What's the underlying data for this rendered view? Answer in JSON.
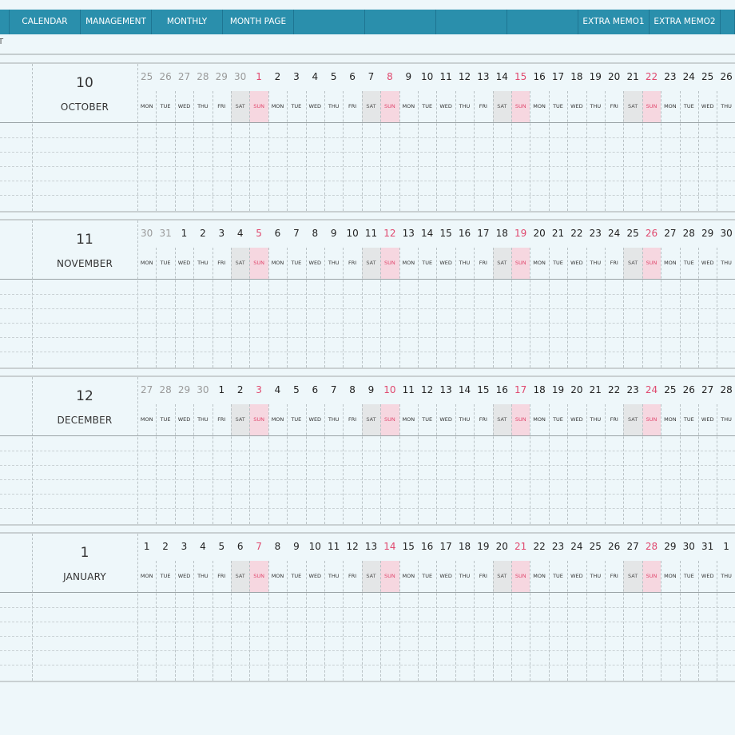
{
  "header": {
    "tabs": [
      {
        "id": "calendar",
        "label": "CALENDAR"
      },
      {
        "id": "management",
        "label": "MANAGEMENT"
      },
      {
        "id": "monthly",
        "label": "MONTHLY"
      },
      {
        "id": "month-page",
        "label": "MONTH PAGE"
      },
      {
        "id": "blank-1",
        "label": ""
      },
      {
        "id": "blank-2",
        "label": ""
      },
      {
        "id": "blank-3",
        "label": ""
      },
      {
        "id": "extra-memo1",
        "label": "EXTRA MEMO1"
      },
      {
        "id": "extra-memo2",
        "label": "EXTRA MEMO2"
      }
    ]
  },
  "sub_label": "T",
  "months": [
    {
      "number": "10",
      "name": "OCTOBER",
      "days": [
        {
          "n": "25",
          "d": "MON",
          "t": "other"
        },
        {
          "n": "26",
          "d": "TUE",
          "t": "other"
        },
        {
          "n": "27",
          "d": "WED",
          "t": "other"
        },
        {
          "n": "28",
          "d": "THU",
          "t": "other"
        },
        {
          "n": "29",
          "d": "FRI",
          "t": "other"
        },
        {
          "n": "30",
          "d": "SAT",
          "t": "other-sat"
        },
        {
          "n": "1",
          "d": "SUN",
          "t": "sun"
        },
        {
          "n": "2",
          "d": "MON",
          "t": ""
        },
        {
          "n": "3",
          "d": "TUE",
          "t": ""
        },
        {
          "n": "4",
          "d": "WED",
          "t": ""
        },
        {
          "n": "5",
          "d": "THU",
          "t": ""
        },
        {
          "n": "6",
          "d": "FRI",
          "t": ""
        },
        {
          "n": "7",
          "d": "SAT",
          "t": "sat"
        },
        {
          "n": "8",
          "d": "SUN",
          "t": "sun"
        },
        {
          "n": "9",
          "d": "MON",
          "t": ""
        },
        {
          "n": "10",
          "d": "TUE",
          "t": ""
        },
        {
          "n": "11",
          "d": "WED",
          "t": ""
        },
        {
          "n": "12",
          "d": "THU",
          "t": ""
        },
        {
          "n": "13",
          "d": "FRI",
          "t": ""
        },
        {
          "n": "14",
          "d": "SAT",
          "t": "sat"
        },
        {
          "n": "15",
          "d": "SUN",
          "t": "sun"
        },
        {
          "n": "16",
          "d": "MON",
          "t": ""
        },
        {
          "n": "17",
          "d": "TUE",
          "t": ""
        },
        {
          "n": "18",
          "d": "WED",
          "t": ""
        },
        {
          "n": "19",
          "d": "THU",
          "t": ""
        },
        {
          "n": "20",
          "d": "FRI",
          "t": ""
        },
        {
          "n": "21",
          "d": "SAT",
          "t": "sat"
        },
        {
          "n": "22",
          "d": "SUN",
          "t": "sun"
        },
        {
          "n": "23",
          "d": "MON",
          "t": ""
        },
        {
          "n": "24",
          "d": "TUE",
          "t": ""
        },
        {
          "n": "25",
          "d": "WED",
          "t": ""
        },
        {
          "n": "26",
          "d": "THU",
          "t": ""
        }
      ]
    },
    {
      "number": "11",
      "name": "NOVEMBER",
      "days": [
        {
          "n": "30",
          "d": "MON",
          "t": "other"
        },
        {
          "n": "31",
          "d": "TUE",
          "t": "other"
        },
        {
          "n": "1",
          "d": "WED",
          "t": ""
        },
        {
          "n": "2",
          "d": "THU",
          "t": ""
        },
        {
          "n": "3",
          "d": "FRI",
          "t": ""
        },
        {
          "n": "4",
          "d": "SAT",
          "t": "sat"
        },
        {
          "n": "5",
          "d": "SUN",
          "t": "sun"
        },
        {
          "n": "6",
          "d": "MON",
          "t": ""
        },
        {
          "n": "7",
          "d": "TUE",
          "t": ""
        },
        {
          "n": "8",
          "d": "WED",
          "t": ""
        },
        {
          "n": "9",
          "d": "THU",
          "t": ""
        },
        {
          "n": "10",
          "d": "FRI",
          "t": ""
        },
        {
          "n": "11",
          "d": "SAT",
          "t": "sat"
        },
        {
          "n": "12",
          "d": "SUN",
          "t": "sun"
        },
        {
          "n": "13",
          "d": "MON",
          "t": ""
        },
        {
          "n": "14",
          "d": "TUE",
          "t": ""
        },
        {
          "n": "15",
          "d": "WED",
          "t": ""
        },
        {
          "n": "16",
          "d": "THU",
          "t": ""
        },
        {
          "n": "17",
          "d": "FRI",
          "t": ""
        },
        {
          "n": "18",
          "d": "SAT",
          "t": "sat"
        },
        {
          "n": "19",
          "d": "SUN",
          "t": "sun"
        },
        {
          "n": "20",
          "d": "MON",
          "t": ""
        },
        {
          "n": "21",
          "d": "TUE",
          "t": ""
        },
        {
          "n": "22",
          "d": "WED",
          "t": ""
        },
        {
          "n": "23",
          "d": "THU",
          "t": ""
        },
        {
          "n": "24",
          "d": "FRI",
          "t": ""
        },
        {
          "n": "25",
          "d": "SAT",
          "t": "sat"
        },
        {
          "n": "26",
          "d": "SUN",
          "t": "sun"
        },
        {
          "n": "27",
          "d": "MON",
          "t": ""
        },
        {
          "n": "28",
          "d": "TUE",
          "t": ""
        },
        {
          "n": "29",
          "d": "WED",
          "t": ""
        },
        {
          "n": "30",
          "d": "THU",
          "t": ""
        }
      ]
    },
    {
      "number": "12",
      "name": "DECEMBER",
      "days": [
        {
          "n": "27",
          "d": "MON",
          "t": "other"
        },
        {
          "n": "28",
          "d": "TUE",
          "t": "other"
        },
        {
          "n": "29",
          "d": "WED",
          "t": "other"
        },
        {
          "n": "30",
          "d": "THU",
          "t": "other"
        },
        {
          "n": "1",
          "d": "FRI",
          "t": ""
        },
        {
          "n": "2",
          "d": "SAT",
          "t": "sat"
        },
        {
          "n": "3",
          "d": "SUN",
          "t": "sun"
        },
        {
          "n": "4",
          "d": "MON",
          "t": ""
        },
        {
          "n": "5",
          "d": "TUE",
          "t": ""
        },
        {
          "n": "6",
          "d": "WED",
          "t": ""
        },
        {
          "n": "7",
          "d": "THU",
          "t": ""
        },
        {
          "n": "8",
          "d": "FRI",
          "t": ""
        },
        {
          "n": "9",
          "d": "SAT",
          "t": "sat"
        },
        {
          "n": "10",
          "d": "SUN",
          "t": "sun"
        },
        {
          "n": "11",
          "d": "MON",
          "t": ""
        },
        {
          "n": "12",
          "d": "TUE",
          "t": ""
        },
        {
          "n": "13",
          "d": "WED",
          "t": ""
        },
        {
          "n": "14",
          "d": "THU",
          "t": ""
        },
        {
          "n": "15",
          "d": "FRI",
          "t": ""
        },
        {
          "n": "16",
          "d": "SAT",
          "t": "sat"
        },
        {
          "n": "17",
          "d": "SUN",
          "t": "sun"
        },
        {
          "n": "18",
          "d": "MON",
          "t": ""
        },
        {
          "n": "19",
          "d": "TUE",
          "t": ""
        },
        {
          "n": "20",
          "d": "WED",
          "t": ""
        },
        {
          "n": "21",
          "d": "THU",
          "t": ""
        },
        {
          "n": "22",
          "d": "FRI",
          "t": ""
        },
        {
          "n": "23",
          "d": "SAT",
          "t": "sat"
        },
        {
          "n": "24",
          "d": "SUN",
          "t": "sun"
        },
        {
          "n": "25",
          "d": "MON",
          "t": ""
        },
        {
          "n": "26",
          "d": "TUE",
          "t": ""
        },
        {
          "n": "27",
          "d": "WED",
          "t": ""
        },
        {
          "n": "28",
          "d": "THU",
          "t": ""
        }
      ]
    },
    {
      "number": "1",
      "name": "JANUARY",
      "days": [
        {
          "n": "1",
          "d": "MON",
          "t": ""
        },
        {
          "n": "2",
          "d": "TUE",
          "t": ""
        },
        {
          "n": "3",
          "d": "WED",
          "t": ""
        },
        {
          "n": "4",
          "d": "THU",
          "t": ""
        },
        {
          "n": "5",
          "d": "FRI",
          "t": ""
        },
        {
          "n": "6",
          "d": "SAT",
          "t": "sat"
        },
        {
          "n": "7",
          "d": "SUN",
          "t": "sun"
        },
        {
          "n": "8",
          "d": "MON",
          "t": ""
        },
        {
          "n": "9",
          "d": "TUE",
          "t": ""
        },
        {
          "n": "10",
          "d": "WED",
          "t": ""
        },
        {
          "n": "11",
          "d": "THU",
          "t": ""
        },
        {
          "n": "12",
          "d": "FRI",
          "t": ""
        },
        {
          "n": "13",
          "d": "SAT",
          "t": "sat"
        },
        {
          "n": "14",
          "d": "SUN",
          "t": "sun"
        },
        {
          "n": "15",
          "d": "MON",
          "t": ""
        },
        {
          "n": "16",
          "d": "TUE",
          "t": ""
        },
        {
          "n": "17",
          "d": "WED",
          "t": ""
        },
        {
          "n": "18",
          "d": "THU",
          "t": ""
        },
        {
          "n": "19",
          "d": "FRI",
          "t": ""
        },
        {
          "n": "20",
          "d": "SAT",
          "t": "sat"
        },
        {
          "n": "21",
          "d": "SUN",
          "t": "sun"
        },
        {
          "n": "22",
          "d": "MON",
          "t": ""
        },
        {
          "n": "23",
          "d": "TUE",
          "t": ""
        },
        {
          "n": "24",
          "d": "WED",
          "t": ""
        },
        {
          "n": "25",
          "d": "THU",
          "t": ""
        },
        {
          "n": "26",
          "d": "FRI",
          "t": ""
        },
        {
          "n": "27",
          "d": "SAT",
          "t": "sat"
        },
        {
          "n": "28",
          "d": "SUN",
          "t": "sun"
        },
        {
          "n": "29",
          "d": "MON",
          "t": ""
        },
        {
          "n": "30",
          "d": "TUE",
          "t": ""
        },
        {
          "n": "31",
          "d": "WED",
          "t": ""
        },
        {
          "n": "1",
          "d": "THU",
          "t": ""
        }
      ]
    }
  ],
  "colors": {
    "header": "#2a8fac",
    "background": "#eef7fa",
    "sunday": "#e0486e",
    "sunday_bg": "#f6d7e0",
    "saturday_bg": "#e4e6e7"
  }
}
